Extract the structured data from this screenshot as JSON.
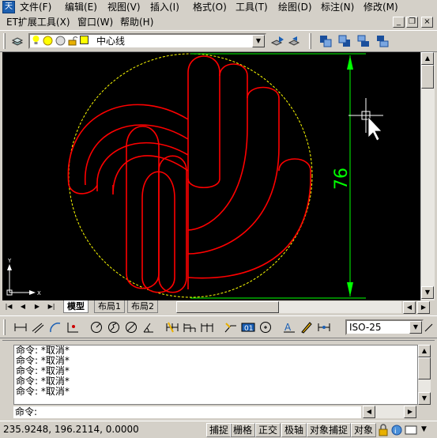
{
  "menubar": {
    "row1": [
      "文件(F)",
      "编辑(E)",
      "视图(V)",
      "插入(I)",
      "格式(O)",
      "工具(T)",
      "绘图(D)",
      "标注(N)",
      "修改(M)"
    ],
    "row2": [
      "ET扩展工具(X)",
      "窗口(W)",
      "帮助(H)"
    ],
    "window_buttons": [
      "_",
      "❐",
      "×"
    ]
  },
  "layer": {
    "current": "中心线"
  },
  "drawing": {
    "dimension": "76"
  },
  "tabs": {
    "items": [
      "模型",
      "布局1",
      "布局2"
    ]
  },
  "dim_style": {
    "value": "ISO-25"
  },
  "command": {
    "history": [
      "命令: *取消*",
      "命令: *取消*",
      "命令: *取消*",
      "命令: *取消*",
      "命令: *取消*"
    ],
    "prompt": "命令:"
  },
  "status": {
    "coordinates": "235.9248, 196.2114, 0.0000",
    "toggles": [
      "捕捉",
      "栅格",
      "正交",
      "极轴",
      "对象捕捉",
      "对象"
    ]
  },
  "colors": {
    "canvas_bg": "#000000",
    "drawing": "#ff0000",
    "dimension": "#00ff00",
    "circle": "#ffff00",
    "chrome": "#d4d0c8"
  }
}
